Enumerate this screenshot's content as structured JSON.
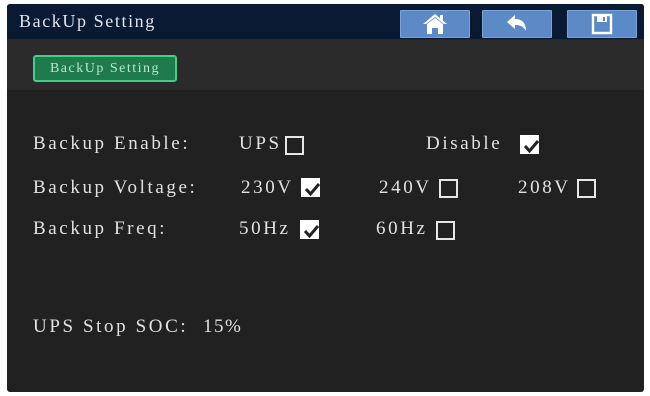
{
  "window": {
    "title": "BackUp Setting"
  },
  "toolbar": {
    "home_icon": "home-icon",
    "back_icon": "back-arrow-icon",
    "save_icon": "save-icon"
  },
  "tab": {
    "label": "BackUp Setting"
  },
  "backup_enable": {
    "label": "Backup Enable:",
    "options": [
      {
        "label": "UPS",
        "checked": false
      },
      {
        "label": "Disable",
        "checked": true
      }
    ]
  },
  "backup_voltage": {
    "label": "Backup Voltage:",
    "options": [
      {
        "label": "230V",
        "checked": true
      },
      {
        "label": "240V",
        "checked": false
      },
      {
        "label": "208V",
        "checked": false
      }
    ]
  },
  "backup_freq": {
    "label": "Backup Freq:",
    "options": [
      {
        "label": "50Hz",
        "checked": true
      },
      {
        "label": "60Hz",
        "checked": false
      }
    ]
  },
  "ups_stop_soc": {
    "label": "UPS Stop SOC:",
    "value": "15%"
  },
  "colors": {
    "title_bar": "#0b1a33",
    "button": "#5b8ac7",
    "tab": "#1f7a4c",
    "tab_border": "#3fcf8a",
    "panel": "#212121"
  }
}
